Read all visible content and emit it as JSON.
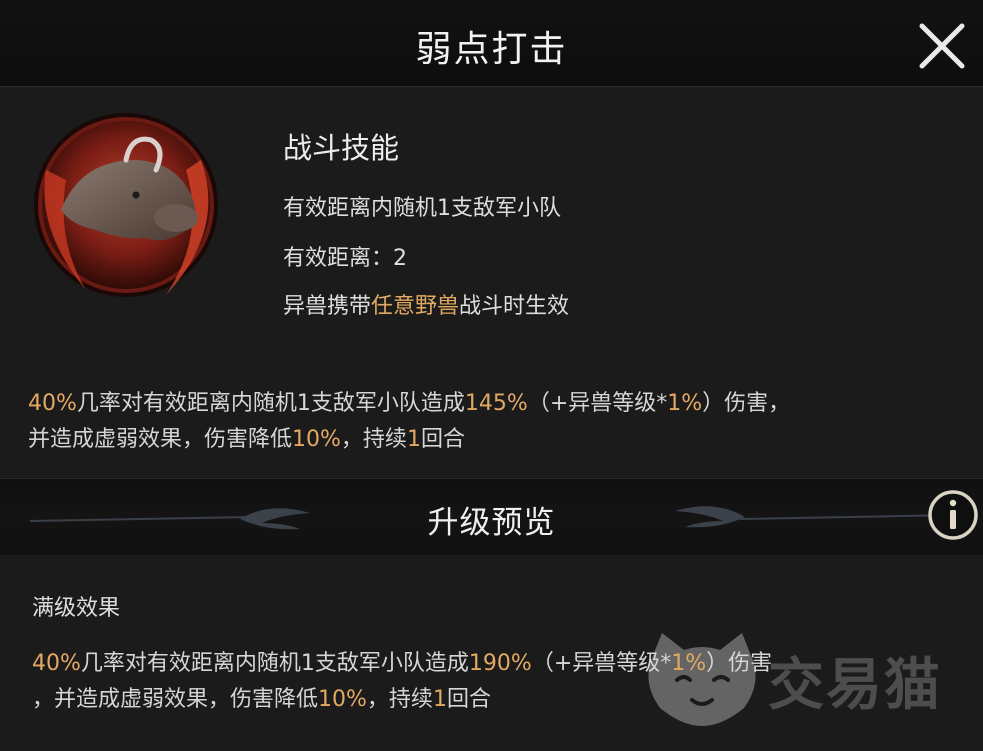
{
  "header": {
    "title": "弱点打击"
  },
  "skill": {
    "type": "战斗技能",
    "target": "有效距离内随机1支敌军小队",
    "range": "有效距离：2",
    "condition_prefix": "异兽携带",
    "condition_highlight": "任意野兽",
    "condition_suffix": "战斗时生效",
    "icon": "boar-beast-icon"
  },
  "current_effect": {
    "chance": "40%",
    "t1": "几率对有效距离内随机1支敌军小队造成",
    "dmg": "145%",
    "t2": "（+异兽等级*",
    "per": "1%",
    "t3": "）伤害，",
    "t4": "并造成虚弱效果，伤害降低",
    "reduce": "10%",
    "t5": "，持续",
    "turns": "1",
    "t6": "回合"
  },
  "preview": {
    "title": "升级预览",
    "max_label": "满级效果",
    "chance": "40%",
    "t1": "几率对有效距离内随机1支敌军小队造成",
    "dmg": "190%",
    "t2": "（+异兽等级*",
    "per": "1%",
    "t3": "）伤害",
    "t4": "，并造成虚弱效果，伤害降低",
    "reduce": "10%",
    "t5": "，持续",
    "turns": "1",
    "t6": "回合"
  },
  "watermark": {
    "text": "交易猫"
  },
  "colors": {
    "highlight": "#e3a963",
    "background": "#1b1b1b",
    "header": "#0d0d0d"
  }
}
